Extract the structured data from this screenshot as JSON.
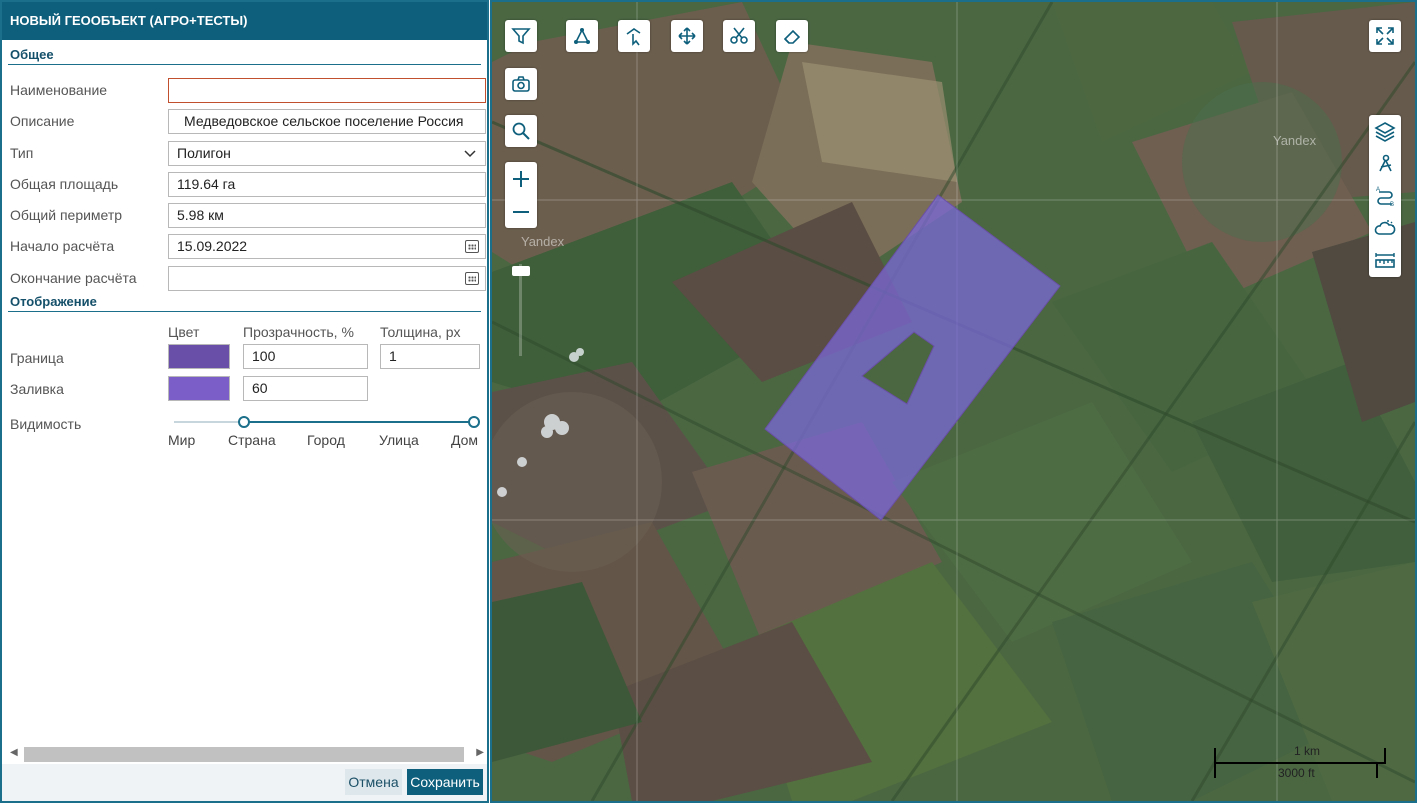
{
  "panel": {
    "title": "НОВЫЙ ГЕООБЪЕКТ (АГРО+ТЕСТЫ)",
    "section_general": "Общее",
    "fields": {
      "name_label": "Наименование",
      "name_value": "",
      "description_label": "Описание",
      "description_value": "Медведовское сельское поселение Россия",
      "type_label": "Тип",
      "type_value": "Полигон",
      "area_label": "Общая площадь",
      "area_value": "119.64 га",
      "perimeter_label": "Общий периметр",
      "perimeter_value": "5.98 км",
      "start_label": "Начало расчёта",
      "start_value": "15.09.2022",
      "end_label": "Окончание расчёта",
      "end_value": ""
    },
    "section_display": "Отображение",
    "display": {
      "col_color": "Цвет",
      "col_opacity": "Прозрачность, %",
      "col_thickness": "Толщина, px",
      "border_label": "Граница",
      "border_color": "#6a4fa8",
      "border_opacity": "100",
      "border_thickness": "1",
      "fill_label": "Заливка",
      "fill_color": "#7c5ec8",
      "fill_opacity": "60",
      "visibility_label": "Видимость",
      "visibility_ticks": [
        "Мир",
        "Страна",
        "Город",
        "Улица",
        "Дом"
      ],
      "visibility_range": [
        "Страна",
        "Дом"
      ]
    },
    "buttons": {
      "cancel": "Отмена",
      "save": "Сохранить"
    }
  },
  "map": {
    "toolbar_top": [
      "filter-icon",
      "draw-polygon-icon",
      "edit-vertex-icon",
      "move-icon",
      "scissors-icon",
      "eraser-icon"
    ],
    "toolbar_left": [
      "camera-icon",
      "search-icon",
      "zoom-in-icon",
      "zoom-out-icon"
    ],
    "toolbar_right": [
      "layers-icon",
      "route-icon",
      "path-a-b-icon",
      "weather-icon",
      "ruler-icon"
    ],
    "fullscreen_icon": "fullscreen-icon",
    "watermark": "Yandex",
    "scale_km": "1 km",
    "scale_ft": "3000 ft",
    "polygon_color": "#7b68d8",
    "accent": "#0e5f7c"
  }
}
